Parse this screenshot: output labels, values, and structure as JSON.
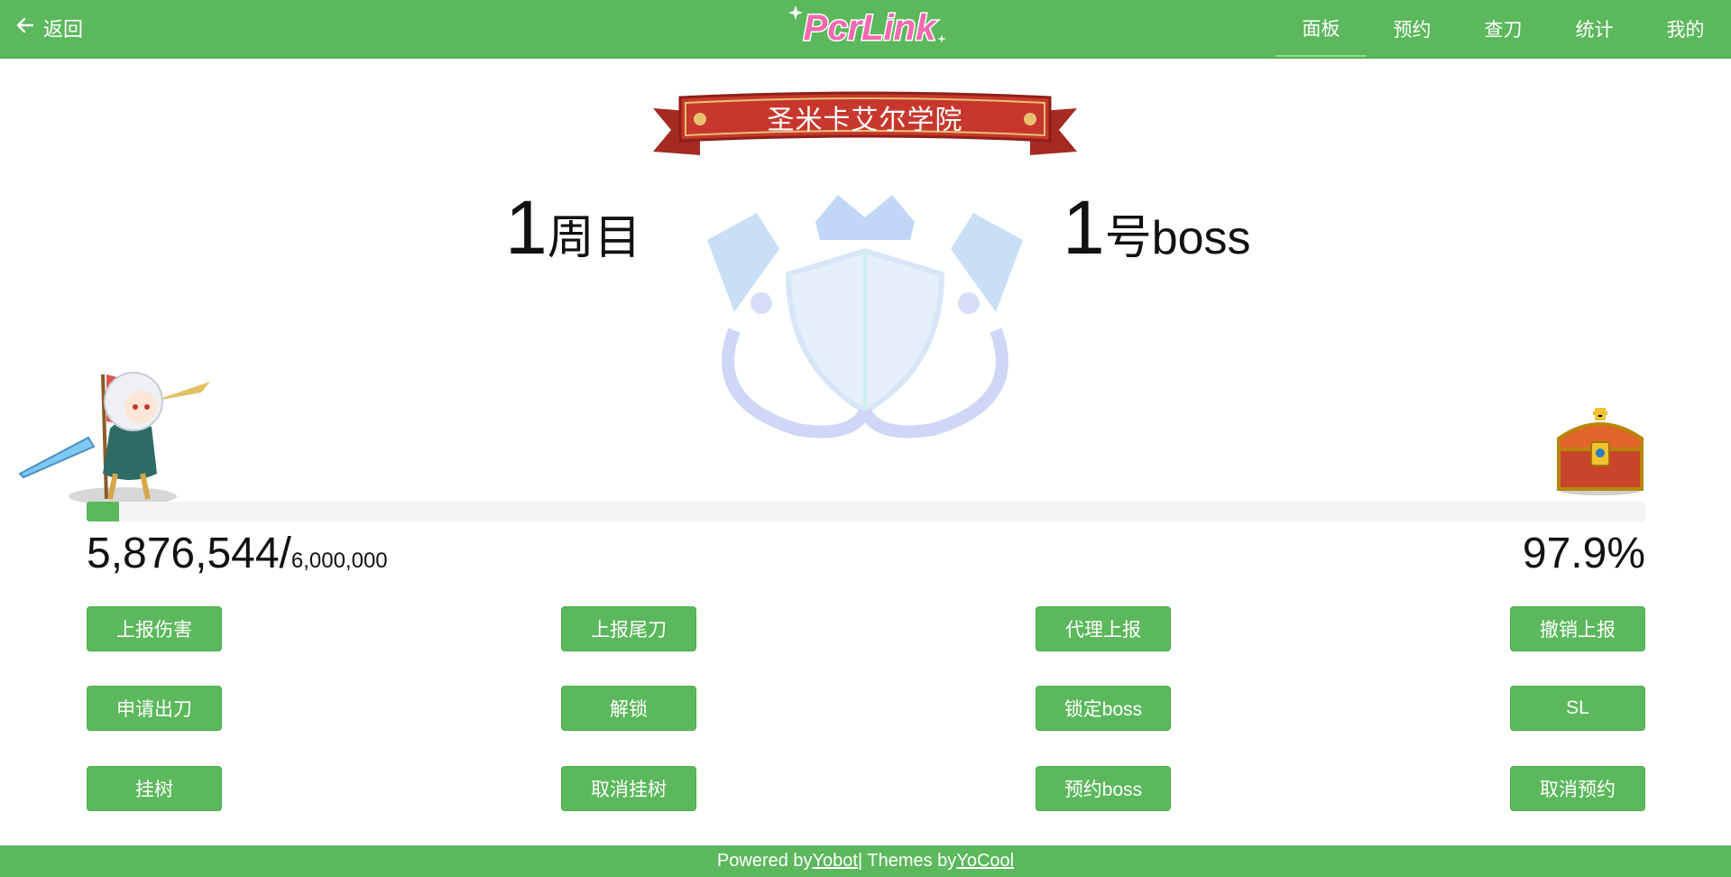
{
  "topbar": {
    "back_label": "返回",
    "logo_text": "PcrLink",
    "nav": [
      {
        "label": "面板",
        "active": true
      },
      {
        "label": "预约",
        "active": false
      },
      {
        "label": "查刀",
        "active": false
      },
      {
        "label": "统计",
        "active": false
      },
      {
        "label": "我的",
        "active": false
      }
    ]
  },
  "clan": {
    "name": "圣米卡艾尔学院"
  },
  "status": {
    "lap": "1",
    "lap_unit": "周目",
    "boss": "1",
    "boss_unit": "号boss",
    "health_current": "5,876,544/",
    "health_max": "6,000,000",
    "health_percent": "97.9%",
    "progress_fraction": 0.021
  },
  "buttons": [
    [
      "上报伤害",
      "上报尾刀",
      "代理上报",
      "撤销上报"
    ],
    [
      "申请出刀",
      "解锁",
      "锁定boss",
      "SL"
    ],
    [
      "挂树",
      "取消挂树",
      "预约boss",
      "取消预约"
    ]
  ],
  "footer": {
    "powered_by": "Powered by ",
    "yobot": "Yobot",
    "separator": " | Themes by ",
    "yocool": "YoCool"
  },
  "colors": {
    "accent": "#5cb85c",
    "banner_red": "#c8372d",
    "logo_pink": "#f06ab0"
  }
}
